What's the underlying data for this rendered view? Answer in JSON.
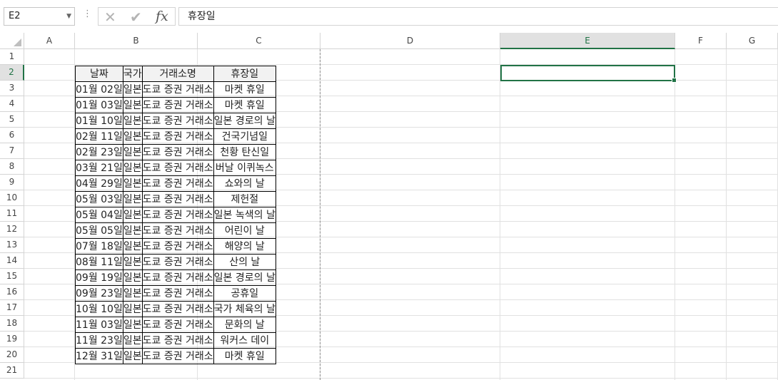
{
  "formula_bar": {
    "name_box": "E2",
    "content": "휴장일",
    "cancel_icon": "x-icon",
    "enter_icon": "check-icon",
    "function_label": "fx"
  },
  "columns": [
    "A",
    "B",
    "C",
    "D",
    "E",
    "F",
    "G"
  ],
  "selected_column": "E",
  "rows": [
    "1",
    "2",
    "3",
    "4",
    "5",
    "6",
    "7",
    "8",
    "9",
    "10",
    "11",
    "12",
    "13",
    "14",
    "15",
    "16",
    "17",
    "18",
    "19",
    "20",
    "21"
  ],
  "selected_row": "2",
  "table": {
    "headers": [
      "날짜",
      "국가",
      "거래소명",
      "휴장일"
    ],
    "rows": [
      [
        "01월 02일",
        "일본",
        "도쿄 증권 거래소",
        "마켓 휴일"
      ],
      [
        "01월 03일",
        "일본",
        "도쿄 증권 거래소",
        "마켓 휴일"
      ],
      [
        "01월 10일",
        "일본",
        "도쿄 증권 거래소",
        "일본 경로의 날"
      ],
      [
        "02월 11일",
        "일본",
        "도쿄 증권 거래소",
        "건국기념일"
      ],
      [
        "02월 23일",
        "일본",
        "도쿄 증권 거래소",
        "천황 탄신일"
      ],
      [
        "03월 21일",
        "일본",
        "도쿄 증권 거래소",
        "버날 이퀴녹스"
      ],
      [
        "04월 29일",
        "일본",
        "도쿄 증권 거래소",
        "쇼와의 날"
      ],
      [
        "05월 03일",
        "일본",
        "도쿄 증권 거래소",
        "제헌절"
      ],
      [
        "05월 04일",
        "일본",
        "도쿄 증권 거래소",
        "일본 녹색의 날"
      ],
      [
        "05월 05일",
        "일본",
        "도쿄 증권 거래소",
        "어린이 날"
      ],
      [
        "07월 18일",
        "일본",
        "도쿄 증권 거래소",
        "해양의 날"
      ],
      [
        "08월 11일",
        "일본",
        "도쿄 증권 거래소",
        "산의 날"
      ],
      [
        "09월 19일",
        "일본",
        "도쿄 증권 거래소",
        "일본 경로의 날"
      ],
      [
        "09월 23일",
        "일본",
        "도쿄 증권 거래소",
        "공휴일"
      ],
      [
        "10월 10일",
        "일본",
        "도쿄 증권 거래소",
        "국가 체육의 날"
      ],
      [
        "11월 03일",
        "일본",
        "도쿄 증권 거래소",
        "문화의 날"
      ],
      [
        "11월 23일",
        "일본",
        "도쿄 증권 거래소",
        "워커스 데이"
      ],
      [
        "12월 31일",
        "일본",
        "도쿄 증권 거래소",
        "마켓 휴일"
      ]
    ]
  }
}
